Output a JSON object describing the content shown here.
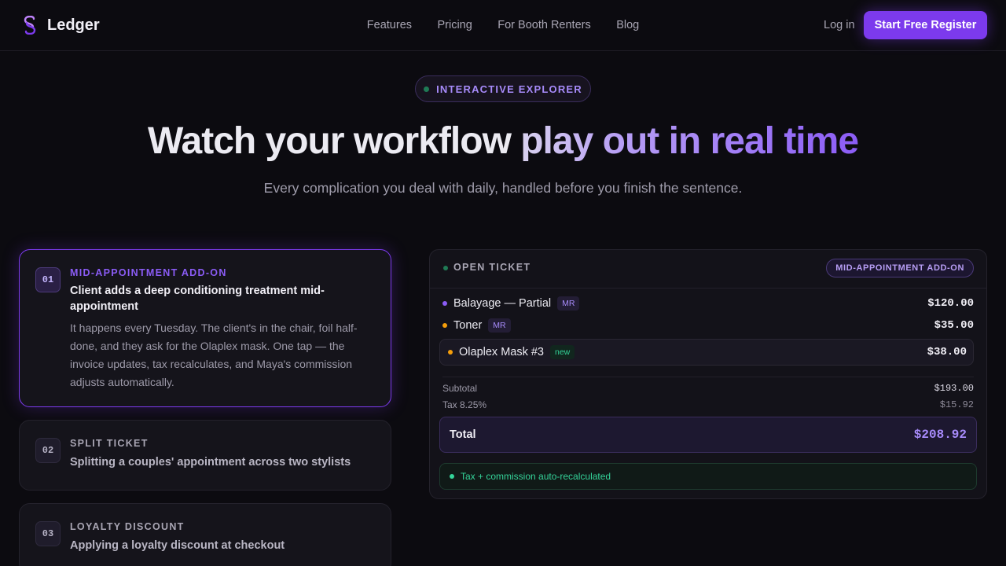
{
  "nav": {
    "brand": "Ledger",
    "brand_icon": "stacked-s-logo-icon",
    "links": [
      "Features",
      "Pricing",
      "For Booth Renters",
      "Blog"
    ],
    "login": "Log in",
    "cta": "Start Free Register"
  },
  "hero": {
    "pill": "INTERACTIVE EXPLORER",
    "headline_a": "Watch your workflow ",
    "headline_b": "play out in real time",
    "subhead": "Every complication you deal with daily, handled before you finish the sentence."
  },
  "scenarios": [
    {
      "num": "01",
      "tag": "MID-APPOINTMENT ADD-ON",
      "title": "Client adds a deep conditioning treatment mid-appointment",
      "body": "It happens every Tuesday. The client's in the chair, foil half-done, and they ask for the Olaplex mask. One tap — the invoice updates, tax recalculates, and Maya's commission adjusts automatically."
    },
    {
      "num": "02",
      "tag": "SPLIT TICKET",
      "title": "Splitting a couples' appointment across two stylists"
    },
    {
      "num": "03",
      "tag": "LOYALTY DISCOUNT",
      "title": "Applying a loyalty discount at checkout"
    }
  ],
  "ticket": {
    "heading": "OPEN TICKET",
    "badge": "MID-APPOINTMENT ADD-ON",
    "lines": [
      {
        "name": "Balayage — Partial",
        "tag": "MR",
        "price": "$120.00",
        "dot": "#8b5cf6"
      },
      {
        "name": "Toner",
        "tag": "MR",
        "price": "$35.00",
        "dot": "#f59e0b"
      },
      {
        "name": "Olaplex Mask #3",
        "tag": "new",
        "price": "$38.00",
        "dot": "#f59e0b"
      }
    ],
    "subtotal_label": "Subtotal",
    "subtotal": "$193.00",
    "tax_label": "Tax 8.25%",
    "tax": "$15.92",
    "total_label": "Total",
    "total": "$208.92",
    "status": "Tax + commission auto-recalculated"
  },
  "colors": {
    "accent": "#7c3aed",
    "accent_light": "#a78bfa",
    "success": "#34d399",
    "background": "#0c0b10"
  }
}
